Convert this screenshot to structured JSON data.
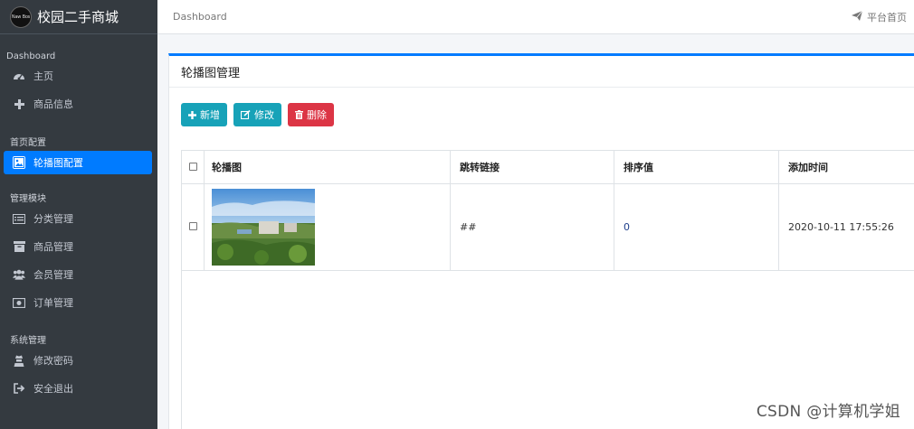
{
  "brand": {
    "logo_text": "Naw Bos",
    "name": "校园二手商城"
  },
  "sidebar": {
    "groups": [
      {
        "header": "Dashboard",
        "items": [
          {
            "label": "主页",
            "icon": "dashboard-icon"
          },
          {
            "label": "商品信息",
            "icon": "plus-icon"
          }
        ]
      },
      {
        "header": "首页配置",
        "items": [
          {
            "label": "轮播图配置",
            "icon": "image-icon",
            "active": true
          }
        ]
      },
      {
        "header": "管理模块",
        "items": [
          {
            "label": "分类管理",
            "icon": "list-icon"
          },
          {
            "label": "商品管理",
            "icon": "archive-icon"
          },
          {
            "label": "会员管理",
            "icon": "users-icon"
          },
          {
            "label": "订单管理",
            "icon": "money-icon"
          }
        ]
      },
      {
        "header": "系统管理",
        "items": [
          {
            "label": "修改密码",
            "icon": "user-secret-icon"
          },
          {
            "label": "安全退出",
            "icon": "sign-out-icon"
          }
        ]
      }
    ]
  },
  "topbar": {
    "breadcrumb": "Dashboard",
    "home_link": "平台首页"
  },
  "card": {
    "title": "轮播图管理"
  },
  "toolbar": {
    "add_label": "新增",
    "edit_label": "修改",
    "delete_label": "删除"
  },
  "table": {
    "headers": [
      "轮播图",
      "跳转链接",
      "排序值",
      "添加时间"
    ],
    "rows": [
      {
        "link": "##",
        "sort": "0",
        "time": "2020-10-11 17:55:26"
      }
    ]
  },
  "colors": {
    "sidebar_bg": "#343a40",
    "accent": "#007bff",
    "info": "#17a2b8",
    "danger": "#dc3545"
  },
  "watermark": "CSDN @计算机学姐"
}
